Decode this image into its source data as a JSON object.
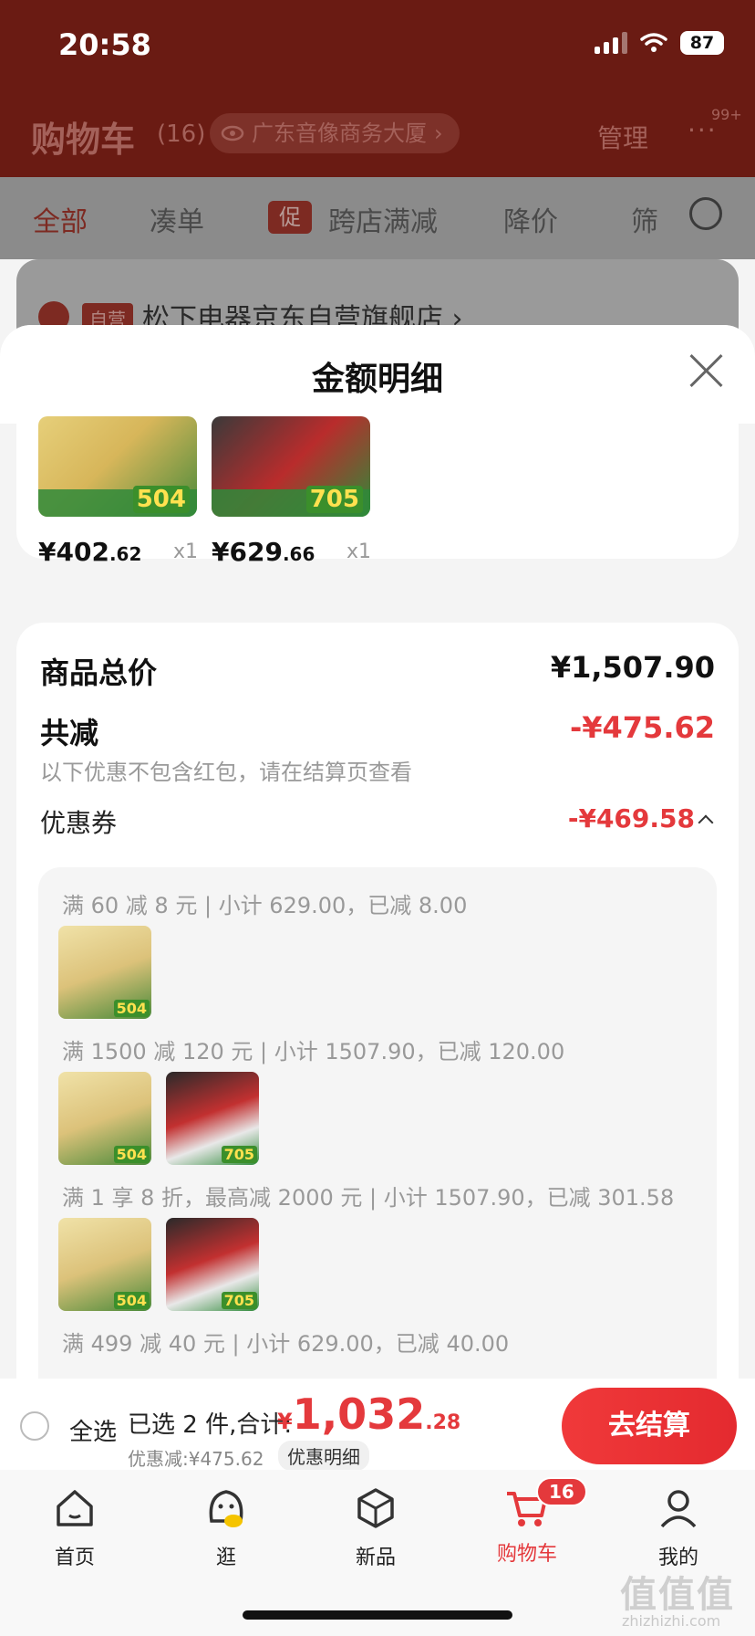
{
  "status": {
    "time": "20:58",
    "battery": "87"
  },
  "cart_header": {
    "title": "购物车",
    "count": "(16)",
    "address": "广东音像商务大厦",
    "manage": "管理",
    "more": "···",
    "more_badge": "99+"
  },
  "cart_tabs": [
    "全部",
    "凑单",
    "促",
    "跨店满减",
    "降价",
    "筛"
  ],
  "store": {
    "tag": "自营",
    "name": "松下电器京东自营旗舰店 ›"
  },
  "sheet": {
    "title": "金额明细",
    "items": [
      {
        "price_int": "¥402",
        "price_dec": ".62",
        "qty": "x1",
        "badge": "504"
      },
      {
        "price_int": "¥629",
        "price_dec": ".66",
        "qty": "x1",
        "badge": "705"
      }
    ],
    "total_label": "商品总价",
    "total_value": "¥1,507.90",
    "discount_label": "共减",
    "discount_value": "-¥475.62",
    "discount_note": "以下优惠不包含红包，请在结算页查看",
    "coupon_label": "优惠券",
    "coupon_value": "-¥469.58",
    "rules": [
      "满 60 减 8 元 | 小计 629.00，已减 8.00",
      "满 1500 减 120 元 | 小计 1507.90，已减 120.00",
      "满 1 享 8 折，最高减 2000 元 | 小计 1507.90，已减 301.58",
      "满 499 减 40 元 | 小计 629.00，已减 40.00"
    ],
    "thumb_badges": [
      "504",
      "705"
    ]
  },
  "checkout": {
    "select_all": "全选",
    "selected": "已选 2 件,合计:",
    "yen": "¥",
    "amount_int": "1,032",
    "amount_dec": ".28",
    "discount": "优惠减:¥475.62",
    "detail_link": "优惠明细",
    "button": "去结算"
  },
  "tabbar": {
    "items": [
      "首页",
      "逛",
      "新品",
      "购物车",
      "我的"
    ],
    "cart_badge": "16"
  },
  "watermark": {
    "main": "值值值",
    "sub": "zhizhizhi.com"
  },
  "colors": {
    "accent": "#e4393c",
    "header_bg": "#6a1b13"
  }
}
